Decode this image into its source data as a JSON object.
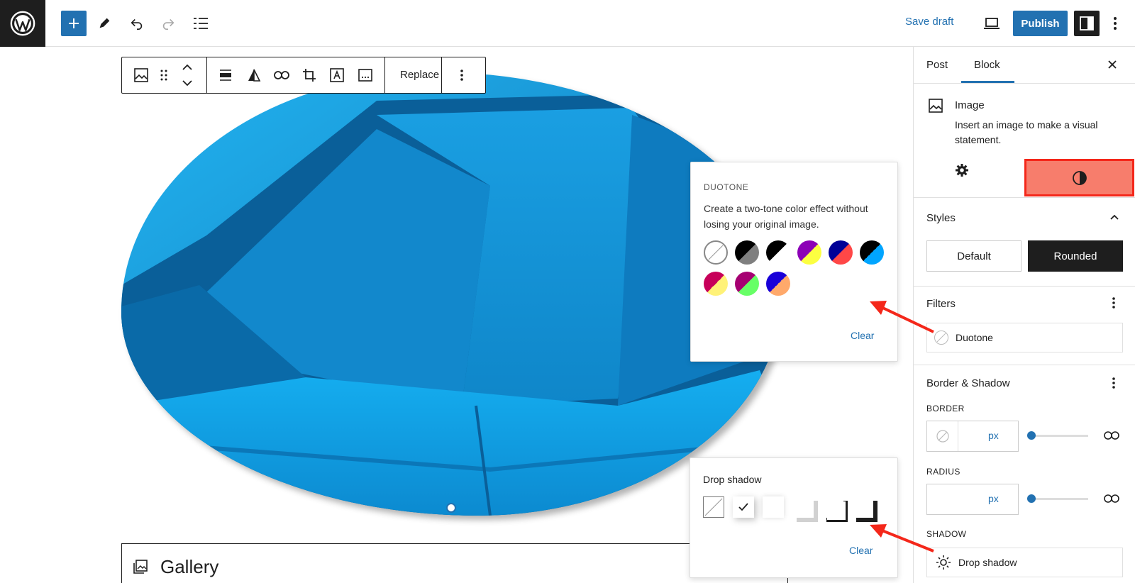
{
  "topbar": {
    "save_draft": "Save draft",
    "publish": "Publish"
  },
  "toolbar": {
    "replace": "Replace"
  },
  "gallery": {
    "label": "Gallery"
  },
  "duotone_popup": {
    "title": "DUOTONE",
    "description": "Create a two-tone color effect without losing your original image.",
    "clear": "Clear",
    "swatches": [
      {
        "name": "none",
        "colors": [
          "#ffffff",
          "#ffffff"
        ]
      },
      {
        "name": "dark-grayscale",
        "colors": [
          "#000000",
          "#7f7f7f"
        ]
      },
      {
        "name": "grayscale",
        "colors": [
          "#000000",
          "#ffffff"
        ]
      },
      {
        "name": "purple-yellow",
        "colors": [
          "#8c00b7",
          "#fcff41"
        ]
      },
      {
        "name": "blue-red",
        "colors": [
          "#000097",
          "#ff4747"
        ]
      },
      {
        "name": "midnight",
        "colors": [
          "#000000",
          "#00a5ff"
        ]
      },
      {
        "name": "magenta-yellow",
        "colors": [
          "#c7005a",
          "#fff278"
        ]
      },
      {
        "name": "purple-green",
        "colors": [
          "#a60072",
          "#67ff66"
        ]
      },
      {
        "name": "blue-orange",
        "colors": [
          "#1900d8",
          "#ffa96b"
        ]
      }
    ]
  },
  "shadow_popup": {
    "title": "Drop shadow",
    "clear": "Clear"
  },
  "sidebar": {
    "tabs": [
      "Post",
      "Block"
    ],
    "block_title": "Image",
    "block_description": "Insert an image to make a visual statement.",
    "styles_title": "Styles",
    "style_default": "Default",
    "style_rounded": "Rounded",
    "filters_title": "Filters",
    "duotone_label": "Duotone",
    "border_shadow_title": "Border & Shadow",
    "border_label": "BORDER",
    "border_unit": "px",
    "radius_label": "RADIUS",
    "radius_unit": "px",
    "shadow_label": "SHADOW",
    "shadow_value": "Drop shadow"
  },
  "colors": {
    "accent": "#2271b1",
    "highlight": "#f77d6c",
    "highlight_border": "#f4271a",
    "annotation_arrow": "#f4271a"
  }
}
